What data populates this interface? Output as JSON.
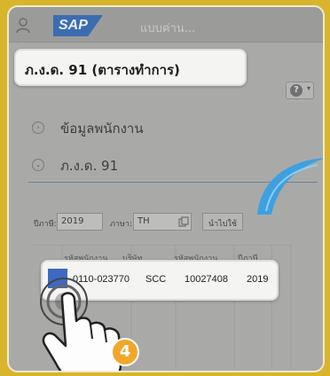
{
  "topbar": {
    "title": "แบบค่าน...",
    "logo_text": "SAP"
  },
  "page": {
    "title": "ภ.ง.ด. 91 (ตารางทำการ)"
  },
  "help_button": {
    "symbol": "?",
    "caret": "▾"
  },
  "sections": [
    {
      "label": "ข้อมูลพนักงาน",
      "state": "collapsed",
      "icon": "›"
    },
    {
      "label": "ภ.ง.ด. 91",
      "state": "expanded",
      "icon": "⌄"
    }
  ],
  "filters": {
    "year_label": "ปีภาษี:",
    "year_value": "2019",
    "lang_label": "ภาษา:",
    "lang_value": "TH",
    "import_button": "นำไปใช้"
  },
  "table": {
    "columns": [
      "รหัสพนักงาน",
      "บริษัท",
      "รหัสพนักงาน",
      "ปีภาษี"
    ],
    "rows": [
      {
        "selected": true,
        "cells": [
          "0110-023770",
          "SCC",
          "10027408",
          "2019"
        ]
      }
    ]
  },
  "tutorial": {
    "step_number": "4"
  },
  "colors": {
    "background": "#d8b52a",
    "selection": "#3e69c2",
    "badge": "#f1a729",
    "swoosh": "#3fa0e0"
  }
}
